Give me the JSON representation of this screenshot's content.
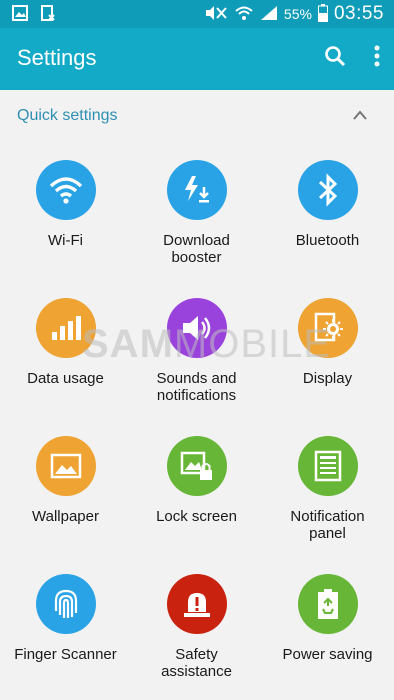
{
  "status_bar": {
    "battery": "55%",
    "time": "03:55",
    "icons": [
      "gallery-icon",
      "sim-icon",
      "mute-icon",
      "wifi-icon",
      "signal-icon",
      "battery-icon"
    ]
  },
  "app_bar": {
    "title": "Settings",
    "actions": [
      "search-icon",
      "more-options-icon"
    ],
    "color": "#13aac8"
  },
  "section": {
    "title": "Quick settings",
    "state": "expanded"
  },
  "quick_settings": [
    {
      "label": "Wi-Fi",
      "icon": "wifi-icon",
      "color": "#2aa3e6"
    },
    {
      "label": "Download\nbooster",
      "icon": "download-booster-icon",
      "color": "#2aa3e6"
    },
    {
      "label": "Bluetooth",
      "icon": "bluetooth-icon",
      "color": "#2aa3e6"
    },
    {
      "label": "Data usage",
      "icon": "data-usage-icon",
      "color": "#eea332"
    },
    {
      "label": "Sounds and\nnotifications",
      "icon": "volume-icon",
      "color": "#9a43dc"
    },
    {
      "label": "Display",
      "icon": "display-icon",
      "color": "#eea332"
    },
    {
      "label": "Wallpaper",
      "icon": "wallpaper-icon",
      "color": "#eea332"
    },
    {
      "label": "Lock screen",
      "icon": "lock-screen-icon",
      "color": "#67b637"
    },
    {
      "label": "Notification\npanel",
      "icon": "notification-panel-icon",
      "color": "#67b637"
    },
    {
      "label": "Finger Scanner",
      "icon": "fingerprint-icon",
      "color": "#2aa3e6"
    },
    {
      "label": "Safety\nassistance",
      "icon": "safety-icon",
      "color": "#c9230f"
    },
    {
      "label": "Power saving",
      "icon": "power-saving-icon",
      "color": "#67b637"
    }
  ],
  "watermark": {
    "bold": "SAM",
    "thin": "MOBILE"
  }
}
